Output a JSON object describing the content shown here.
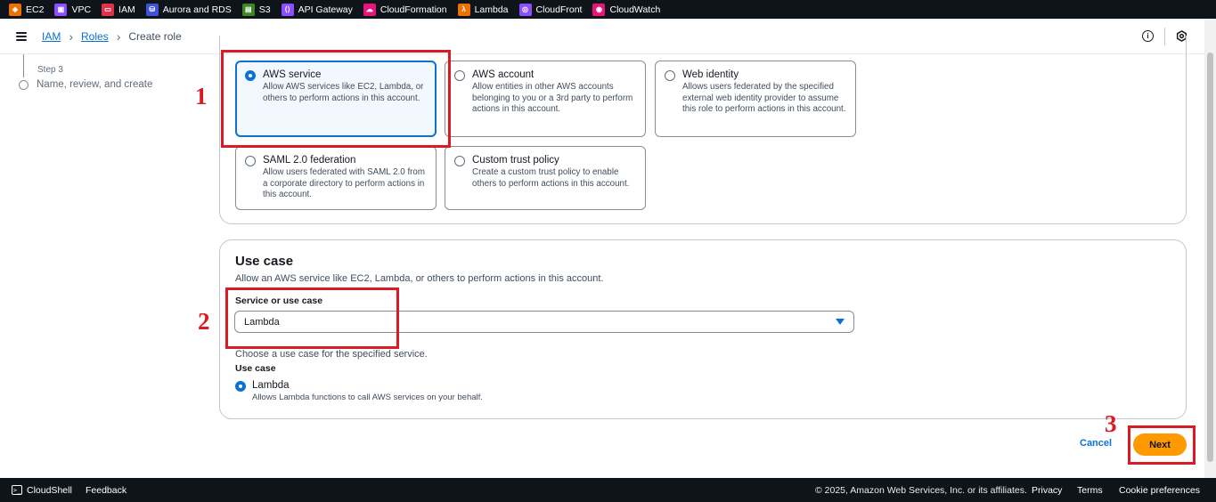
{
  "topbar": {
    "services": [
      {
        "label": "EC2",
        "icon": "ec2-icon",
        "color": "#ed7100"
      },
      {
        "label": "VPC",
        "icon": "vpc-icon",
        "color": "#8c4fff"
      },
      {
        "label": "IAM",
        "icon": "iam-icon",
        "color": "#dd344c"
      },
      {
        "label": "Aurora and RDS",
        "icon": "rds-icon",
        "color": "#4053d6"
      },
      {
        "label": "S3",
        "icon": "s3-icon",
        "color": "#3f8624"
      },
      {
        "label": "API Gateway",
        "icon": "api-gateway-icon",
        "color": "#8c4fff"
      },
      {
        "label": "CloudFormation",
        "icon": "cloudformation-icon",
        "color": "#e7157b"
      },
      {
        "label": "Lambda",
        "icon": "lambda-icon",
        "color": "#ed7100"
      },
      {
        "label": "CloudFront",
        "icon": "cloudfront-icon",
        "color": "#8c4fff"
      },
      {
        "label": "CloudWatch",
        "icon": "cloudwatch-icon",
        "color": "#e7157b"
      }
    ]
  },
  "breadcrumb": {
    "items": [
      "IAM",
      "Roles"
    ],
    "current": "Create role"
  },
  "steps": {
    "step_label": "Step 3",
    "step_name": "Name, review, and create"
  },
  "trusted_entity": {
    "options": [
      {
        "title": "AWS service",
        "desc": "Allow AWS services like EC2, Lambda, or others to perform actions in this account.",
        "selected": true
      },
      {
        "title": "AWS account",
        "desc": "Allow entities in other AWS accounts belonging to you or a 3rd party to perform actions in this account.",
        "selected": false
      },
      {
        "title": "Web identity",
        "desc": "Allows users federated by the specified external web identity provider to assume this role to perform actions in this account.",
        "selected": false
      },
      {
        "title": "SAML 2.0 federation",
        "desc": "Allow users federated with SAML 2.0 from a corporate directory to perform actions in this account.",
        "selected": false
      },
      {
        "title": "Custom trust policy",
        "desc": "Create a custom trust policy to enable others to perform actions in this account.",
        "selected": false
      }
    ]
  },
  "use_case": {
    "heading": "Use case",
    "description": "Allow an AWS service like EC2, Lambda, or others to perform actions in this account.",
    "field_label": "Service or use case",
    "selected_service": "Lambda",
    "hint": "Choose a use case for the specified service.",
    "use_case_label": "Use case",
    "option_title": "Lambda",
    "option_desc": "Allows Lambda functions to call AWS services on your behalf."
  },
  "actions": {
    "cancel_label": "Cancel",
    "next_label": "Next"
  },
  "annotations": [
    "1",
    "2",
    "3"
  ],
  "footer": {
    "cloudshell_label": "CloudShell",
    "feedback_label": "Feedback",
    "copyright": "© 2025, Amazon Web Services, Inc. or its affiliates.",
    "privacy_label": "Privacy",
    "terms_label": "Terms",
    "cookie_label": "Cookie preferences"
  },
  "colors": {
    "accent": "#0972d3",
    "primary_button": "#ff9900",
    "annotation": "#d81b24",
    "bar_bg": "#0f141a"
  }
}
